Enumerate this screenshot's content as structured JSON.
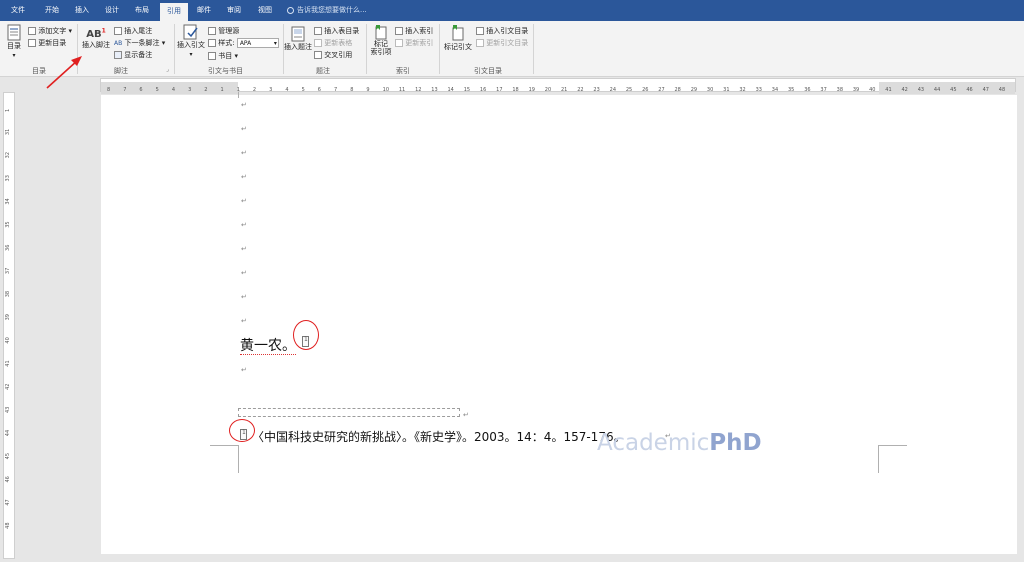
{
  "tabs": [
    {
      "label": "文件",
      "active": false
    },
    {
      "label": "开始",
      "active": false
    },
    {
      "label": "插入",
      "active": false
    },
    {
      "label": "设计",
      "active": false
    },
    {
      "label": "布局",
      "active": false
    },
    {
      "label": "引用",
      "active": true
    },
    {
      "label": "邮件",
      "active": false
    },
    {
      "label": "审阅",
      "active": false
    },
    {
      "label": "视图",
      "active": false
    }
  ],
  "tell_me": "告诉我您想要做什么...",
  "ribbon": {
    "toc": {
      "toc_button": "目录",
      "add_text": "添加文字",
      "update_toc": "更新目录",
      "group_label": "目录"
    },
    "footnotes": {
      "insert_footnote": "插入脚注",
      "insert_endnote": "插入尾注",
      "next_footnote": "下一条脚注",
      "show_notes": "显示备注",
      "group_label": "脚注"
    },
    "citations": {
      "insert_citation": "插入引文",
      "manage_sources": "管理源",
      "style_label": "样式:",
      "style_value": "APA",
      "bibliography": "书目",
      "group_label": "引文与书目"
    },
    "captions": {
      "insert_caption": "插入题注",
      "insert_table_of_figures": "插入表目录",
      "update_table": "更新表格",
      "cross_reference": "交叉引用",
      "group_label": "题注"
    },
    "index": {
      "mark_entry_line1": "标记",
      "mark_entry_line2": "索引项",
      "insert_index": "插入索引",
      "update_index": "更新索引",
      "group_label": "索引"
    },
    "authorities": {
      "mark_citation": "标记引文",
      "insert_table_of_authorities": "插入引文目录",
      "update_table": "更新引文目录",
      "group_label": "引文目录"
    }
  },
  "ruler_h_labels": [
    "8",
    "7",
    "6",
    "5",
    "4",
    "3",
    "2",
    "1",
    "1",
    "2",
    "3",
    "4",
    "5",
    "6",
    "7",
    "8",
    "9",
    "10",
    "11",
    "12",
    "13",
    "14",
    "15",
    "16",
    "17",
    "18",
    "19",
    "20",
    "21",
    "22",
    "23",
    "24",
    "25",
    "26",
    "27",
    "28",
    "29",
    "30",
    "31",
    "32",
    "33",
    "34",
    "35",
    "36",
    "37",
    "38",
    "39",
    "40",
    "41",
    "42",
    "43",
    "44",
    "45",
    "46",
    "47",
    "48"
  ],
  "ruler_v_labels": [
    "1",
    "31",
    "32",
    "33",
    "34",
    "35",
    "36",
    "37",
    "38",
    "39",
    "40",
    "41",
    "42",
    "43",
    "44",
    "45",
    "46",
    "47",
    "48"
  ],
  "document": {
    "paragraph_mark": "↵",
    "body_text": "黄一农。",
    "footnote_ref": "1",
    "footnote_text": "〈中国科技史研究的新挑战〉。《新史学》。2003。14：4。157-176。",
    "watermark_light": "Academic",
    "watermark_bold": "PhD"
  },
  "colors": {
    "titlebar": "#2b579a",
    "annotation": "#e02020",
    "ribbon_bg": "#f3f3f3"
  }
}
